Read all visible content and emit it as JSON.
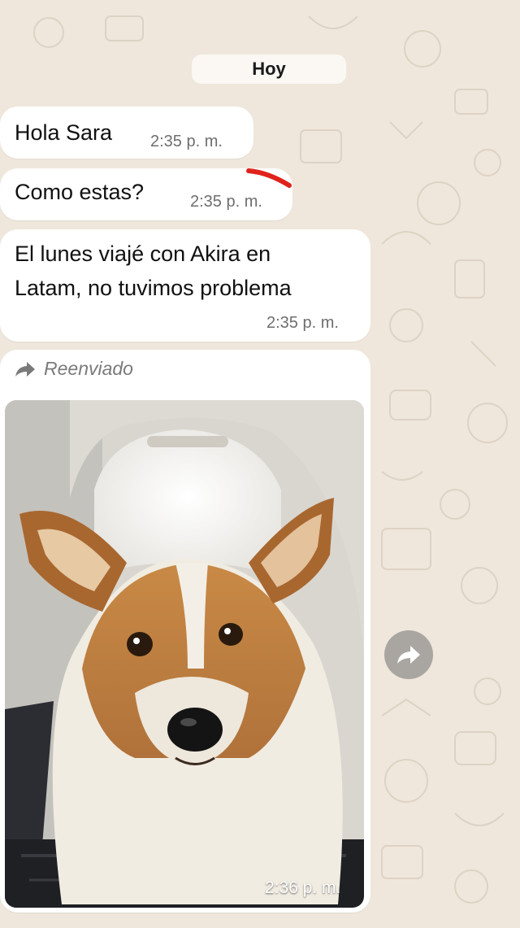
{
  "chat": {
    "day_label": "Hoy",
    "messages": [
      {
        "text": "Hola Sara",
        "time": "2:35 p. m."
      },
      {
        "text": "Como estas?",
        "time": "2:35 p. m."
      },
      {
        "lines": [
          "El lunes viajé con Akira en",
          "Latam, no tuvimos problema"
        ],
        "time": "2:35 p. m."
      },
      {
        "forwarded_label": "Reenviado",
        "time": "2:36 p. m."
      }
    ]
  },
  "icons": {
    "forward": "forward-arrow-icon",
    "share": "share-forward-icon"
  },
  "colors": {
    "background": "#efe7dc",
    "bubble": "#ffffff",
    "timestamp": "#6e6e6e",
    "share_button": "#a9a6a2",
    "annotation": "#e0221c"
  }
}
